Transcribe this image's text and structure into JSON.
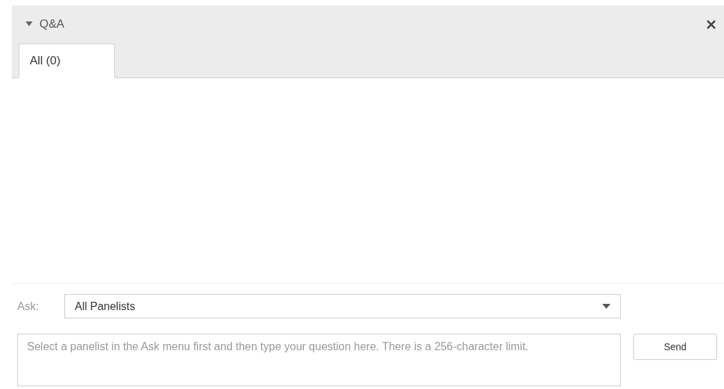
{
  "panel": {
    "title": "Q&A",
    "expanded": true
  },
  "tabs": [
    {
      "label": "All (0)",
      "selected": true
    }
  ],
  "ask": {
    "label": "Ask:",
    "value": "All Panelists"
  },
  "question": {
    "placeholder": "Select a panelist in the Ask menu first and then type your question here. There is a 256-character limit."
  },
  "buttons": [
    "Send"
  ]
}
